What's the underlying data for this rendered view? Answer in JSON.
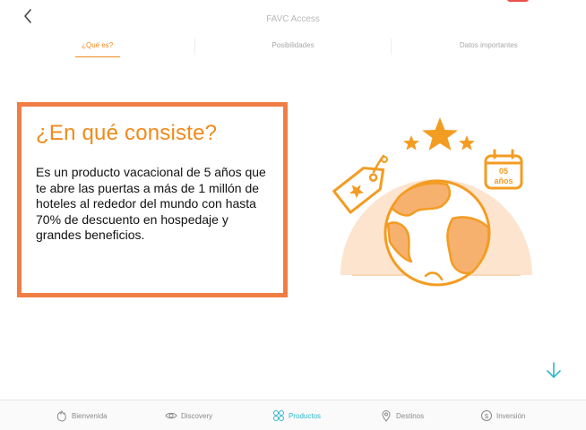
{
  "header": {
    "title": "FAVC Access",
    "back_icon": "chevron-left-icon"
  },
  "tabs": [
    {
      "label": "¿Qué es?",
      "active": true
    },
    {
      "label": "Posibilidades",
      "active": false
    },
    {
      "label": "Datos importantes",
      "active": false
    }
  ],
  "card": {
    "heading": "¿En qué consiste?",
    "body": "Es un producto vacacional de 5 años que te abre las puertas a más de 1 millón de hoteles al rededor del mundo con hasta 70% de descuento en hospedaje y grandes beneficios."
  },
  "illustration": {
    "calendar_number": "05",
    "calendar_label": "años"
  },
  "bottom_nav": [
    {
      "label": "Bienvenida",
      "icon": "hand-wave-icon",
      "active": false
    },
    {
      "label": "Discovery",
      "icon": "eye-icon",
      "active": false
    },
    {
      "label": "Productos",
      "icon": "grid-circles-icon",
      "active": true
    },
    {
      "label": "Destinos",
      "icon": "map-pin-icon",
      "active": false
    },
    {
      "label": "Inversión",
      "icon": "dollar-coin-icon",
      "active": false
    }
  ],
  "colors": {
    "accent": "#f08a1c",
    "card_border": "#ef7d44",
    "nav_active": "#2fb7c9",
    "illustration_bg": "#fde4cf"
  }
}
